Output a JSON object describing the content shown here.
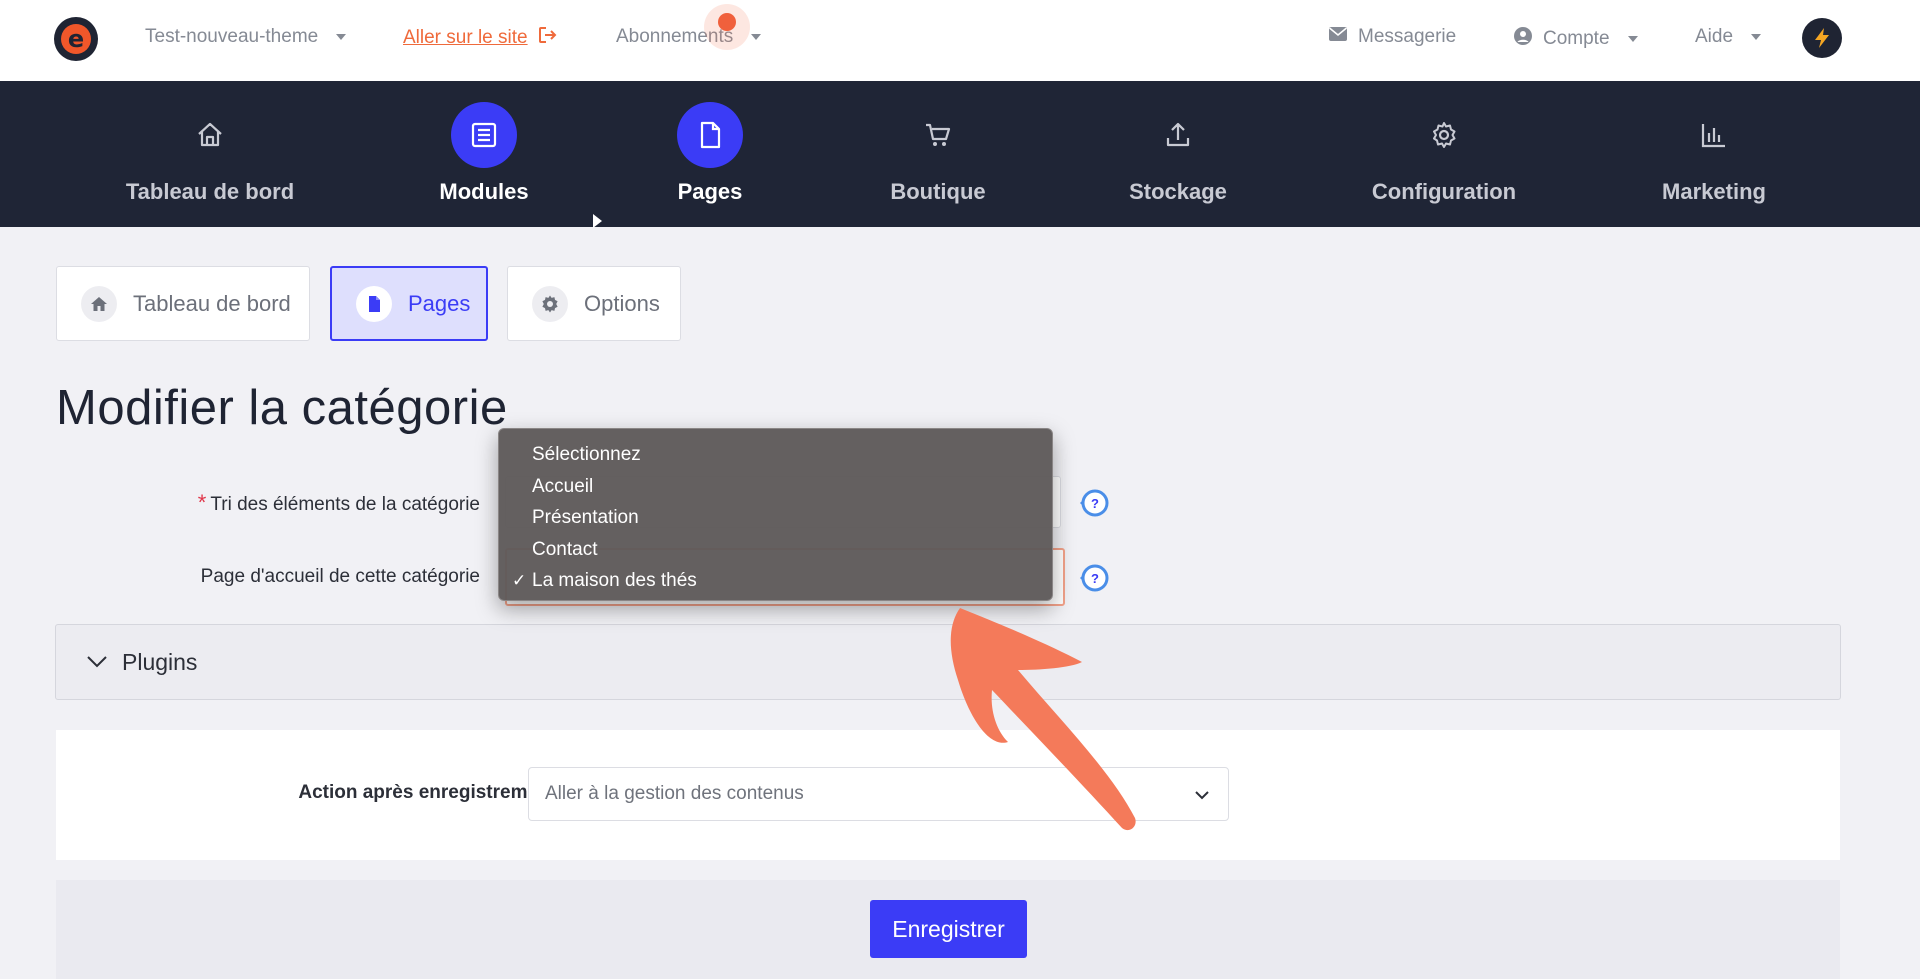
{
  "topbar": {
    "site_name": "Test-nouveau-theme",
    "site_link": "Aller sur le site",
    "subscriptions": "Abonnements",
    "messaging": "Messagerie",
    "account": "Compte",
    "help": "Aide"
  },
  "main_nav": {
    "items": [
      {
        "label": "Tableau de bord",
        "icon": "home-icon",
        "active": false
      },
      {
        "label": "Modules",
        "icon": "list-icon",
        "active": true
      },
      {
        "label": "Pages",
        "icon": "file-icon",
        "active": true
      },
      {
        "label": "Boutique",
        "icon": "cart-icon",
        "active": false
      },
      {
        "label": "Stockage",
        "icon": "upload-icon",
        "active": false
      },
      {
        "label": "Configuration",
        "icon": "gear-icon",
        "active": false
      },
      {
        "label": "Marketing",
        "icon": "bar-chart-icon",
        "active": false
      }
    ]
  },
  "sub_tabs": [
    {
      "label": "Tableau de bord",
      "icon": "home-icon",
      "active": false
    },
    {
      "label": "Pages",
      "icon": "file-icon",
      "active": true
    },
    {
      "label": "Options",
      "icon": "gear-icon",
      "active": false
    }
  ],
  "page": {
    "title": "Modifier la catégorie"
  },
  "form": {
    "sort_label": "Tri des éléments de la catégorie",
    "sort_required_mark": "*",
    "home_page_label": "Page d'accueil de cette catégorie",
    "home_page_options": [
      {
        "label": "Sélectionnez",
        "selected": false
      },
      {
        "label": "Accueil",
        "selected": false
      },
      {
        "label": "Présentation",
        "selected": false
      },
      {
        "label": "Contact",
        "selected": false
      },
      {
        "label": "La maison des thés",
        "selected": true
      }
    ],
    "check_mark": "✓"
  },
  "plugins": {
    "label": "Plugins"
  },
  "after_save": {
    "label": "Action après enregistrement",
    "value": "Aller à la gestion des contenus"
  },
  "save_button": "Enregistrer",
  "colors": {
    "accent": "#3b3cf6",
    "nav_bg": "#1f2536",
    "link_orange": "#ef6a3b",
    "annotation_arrow": "#f47a5a",
    "required": "#e0364a"
  }
}
